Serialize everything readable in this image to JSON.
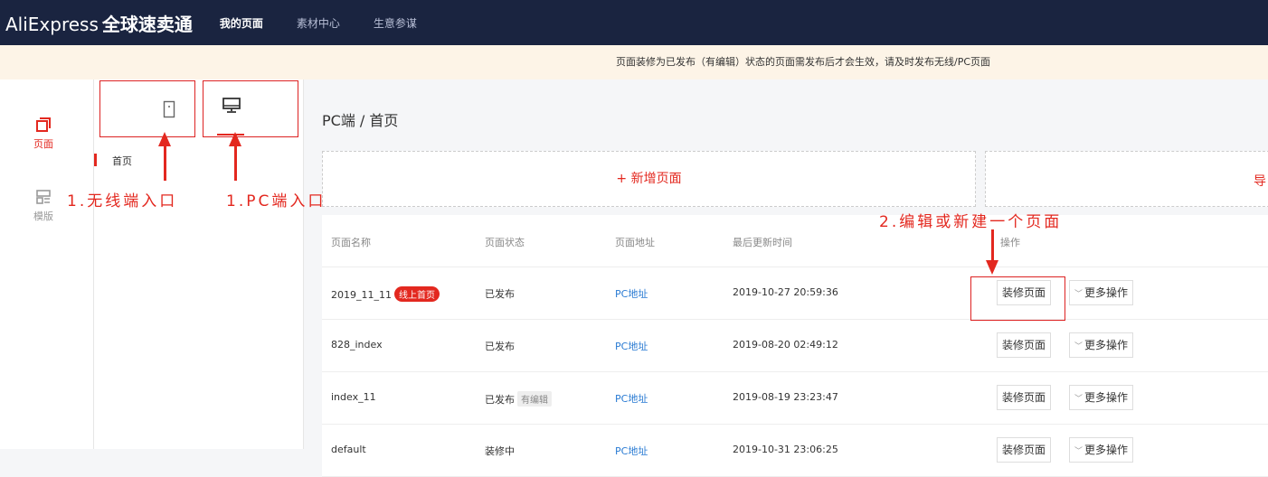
{
  "topbar": {
    "logo_text": "AliExpress",
    "logo_cn": "全球速卖通",
    "nav": [
      {
        "label": "我的页面",
        "active": true
      },
      {
        "label": "素材中心",
        "active": false
      },
      {
        "label": "生意参谋",
        "active": false
      }
    ]
  },
  "notice": {
    "text": "页面装修为已发布（有编辑）状态的页面需发布后才会生效，请及时发布无线/PC页面"
  },
  "left_rail": {
    "items": [
      {
        "label": "页面",
        "icon": "pages-icon",
        "active": true
      },
      {
        "label": "模版",
        "icon": "template-icon",
        "active": false
      }
    ]
  },
  "sub_panel": {
    "devices": [
      {
        "name": "mobile-icon"
      },
      {
        "name": "desktop-icon"
      }
    ],
    "page_items": [
      {
        "label": "首页"
      }
    ]
  },
  "main": {
    "breadcrumb": "PC端 / 首页",
    "add_page_label": "+ 新增页面",
    "add_box2_label": "导",
    "columns": [
      "页面名称",
      "页面状态",
      "页面地址",
      "最后更新时间",
      "操作"
    ],
    "rows": [
      {
        "name": "2019_11_11",
        "name_badge": "线上首页",
        "status": "已发布",
        "status_badge": "",
        "url": "PC地址",
        "updated": "2019-10-27 20:59:36",
        "edit": "装修页面",
        "more": "更多操作"
      },
      {
        "name": "828_index",
        "name_badge": "",
        "status": "已发布",
        "status_badge": "",
        "url": "PC地址",
        "updated": "2019-08-20 02:49:12",
        "edit": "装修页面",
        "more": "更多操作"
      },
      {
        "name": "index_11",
        "name_badge": "",
        "status": "已发布",
        "status_badge": "有编辑",
        "url": "PC地址",
        "updated": "2019-08-19 23:23:47",
        "edit": "装修页面",
        "more": "更多操作"
      },
      {
        "name": "default",
        "name_badge": "",
        "status": "装修中",
        "status_badge": "",
        "url": "PC地址",
        "updated": "2019-10-31 23:06:25",
        "edit": "装修页面",
        "more": "更多操作"
      }
    ]
  },
  "annotations": {
    "mobile_entry": "1.无线端入口",
    "pc_entry": "1.PC端入口",
    "edit_hint": "2.编辑或新建一个页面"
  },
  "colors": {
    "accent": "#e3281f",
    "topbar": "#1a2440",
    "link": "#2a7bd3"
  }
}
